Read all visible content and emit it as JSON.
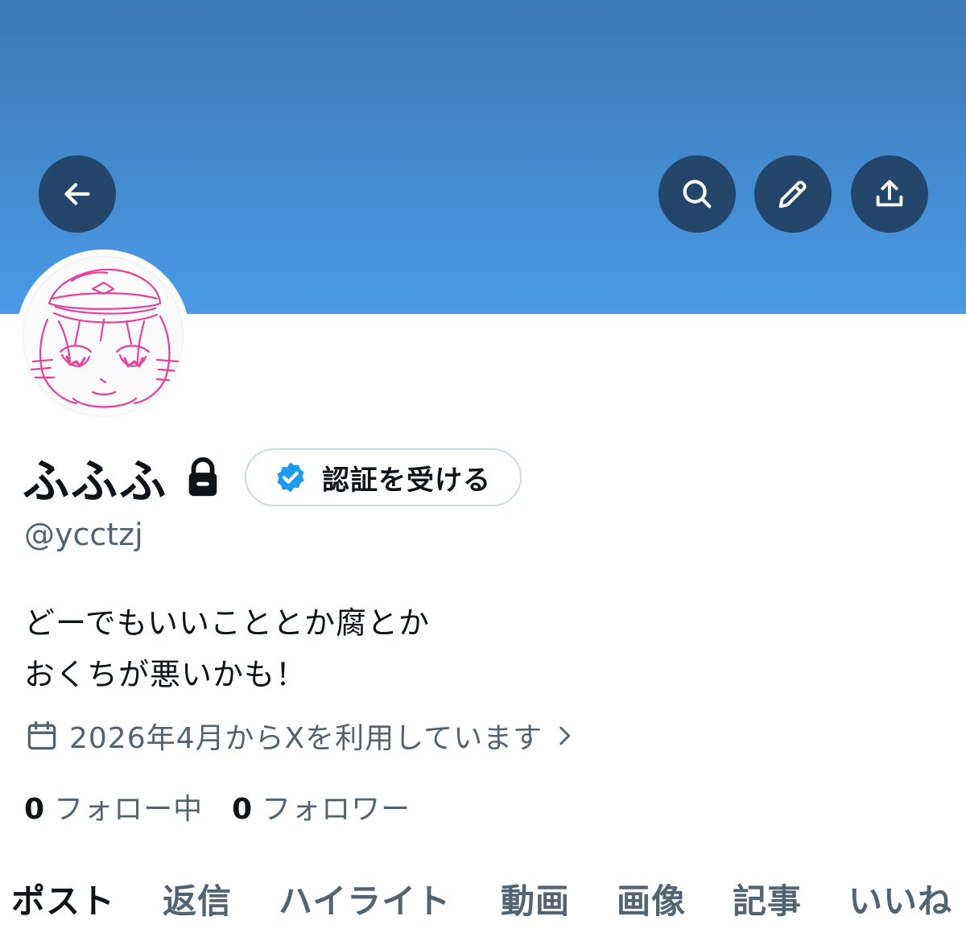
{
  "profile": {
    "display_name": "ふふふ",
    "handle": "@ycctzj",
    "bio_line1": "どーでもいいこととか腐とか",
    "bio_line2": "おくちが悪いかも！",
    "joined": "2026年4月からXを利用しています",
    "verify_label": "認証を受ける"
  },
  "stats": {
    "following_count": "0",
    "following_label": "フォロー中",
    "followers_count": "0",
    "followers_label": "フォロワー"
  },
  "tabs": [
    {
      "label": "ポスト",
      "active": true
    },
    {
      "label": "返信",
      "active": false
    },
    {
      "label": "ハイライト",
      "active": false
    },
    {
      "label": "動画",
      "active": false
    },
    {
      "label": "画像",
      "active": false
    },
    {
      "label": "記事",
      "active": false
    },
    {
      "label": "いいね",
      "active": false
    }
  ],
  "icons": {
    "back": "arrow-left-icon",
    "search": "search-icon",
    "edit": "pencil-icon",
    "share": "share-icon",
    "lock": "lock-icon",
    "verified": "verified-badge-icon",
    "calendar": "calendar-icon",
    "chevron": "chevron-right-icon"
  },
  "colors": {
    "banner_top": "#3c78b4",
    "banner_bottom": "#4a9ae6",
    "button_bg": "#25466b",
    "verified_blue": "#1d9bf0",
    "text_primary": "#0f1419",
    "text_secondary": "#536471",
    "avatar_sketch": "#e8409a"
  }
}
